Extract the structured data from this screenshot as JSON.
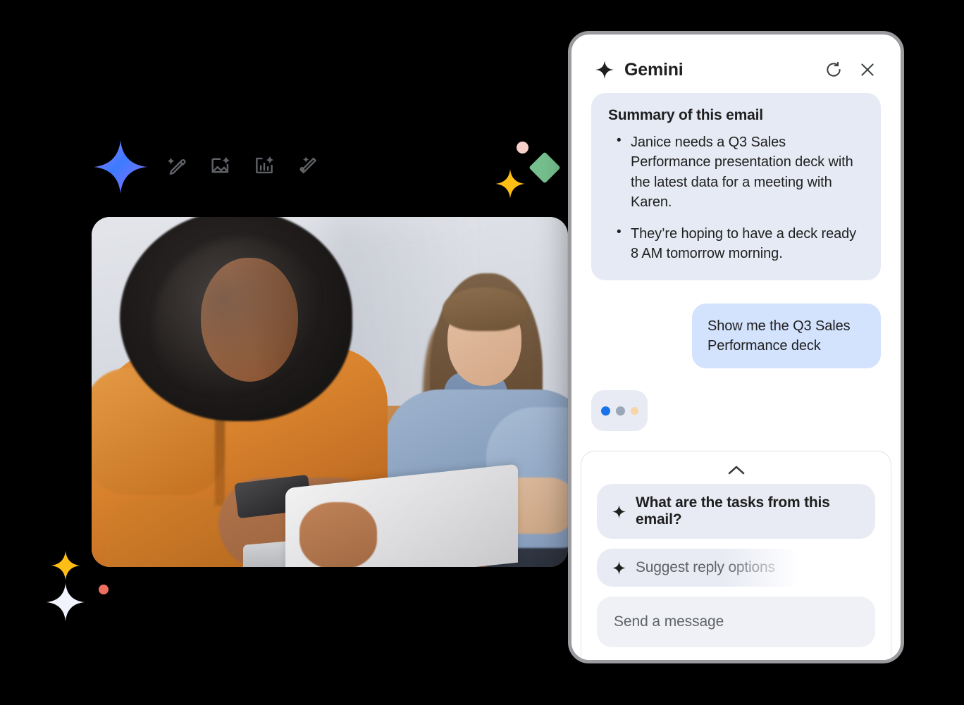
{
  "panel": {
    "title": "Gemini",
    "icons": {
      "brand": "gemini-sparkle-icon",
      "refresh": "refresh-icon",
      "close": "close-icon"
    }
  },
  "summary": {
    "heading": "Summary of this email",
    "bullets": [
      "Janice needs a Q3 Sales Performance presentation deck with the latest data for a meeting with Karen.",
      "They’re hoping to have a deck ready 8 AM tomorrow morning."
    ]
  },
  "conversation": {
    "user_message": "Show me the Q3 Sales Performance deck",
    "typing_indicator": {
      "label": "assistant-typing",
      "dot_colors": [
        "#1a73e8",
        "#9aa7b8",
        "#f6d6a8"
      ]
    }
  },
  "bottom_sheet": {
    "expand_label": "expand-suggestions",
    "suggestions": [
      {
        "label": "What are the tasks from this email?",
        "state": "active"
      },
      {
        "label": "Suggest reply options",
        "state": "faded"
      }
    ],
    "input_placeholder": "Send a message"
  },
  "decor": {
    "icons": [
      "sparkle-star-icon",
      "pencil-sparkle-icon",
      "image-sparkle-icon",
      "chart-sparkle-icon",
      "magic-wand-icon"
    ],
    "shapes": [
      {
        "name": "pink-dot",
        "color": "#f9cfcb"
      },
      {
        "name": "green-diamond",
        "color": "#76c08f"
      },
      {
        "name": "yellow-star",
        "color": "#ffbe16"
      },
      {
        "name": "yellow-star-small",
        "color": "#ffbe16"
      },
      {
        "name": "white-star",
        "color": "#f1f3fd"
      },
      {
        "name": "red-dot",
        "color": "#ef6f5e"
      }
    ]
  },
  "photo": {
    "name": "two-women-with-laptop-on-couch",
    "alt": "Two women sitting on a couch looking at a laptop together"
  },
  "colors": {
    "accent_blue": "#1a73e8",
    "user_bubble": "#d3e2fd",
    "summary_card": "#e6eaf4",
    "chip": "#e8ebf3",
    "input": "#eff1f6",
    "text": "#1f1f1f"
  }
}
